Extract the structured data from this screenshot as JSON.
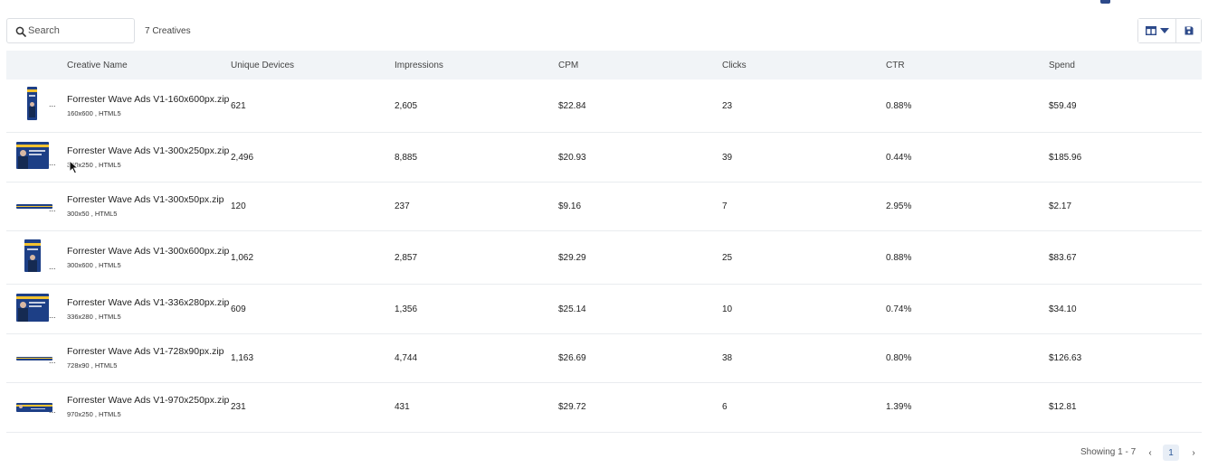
{
  "search": {
    "placeholder": "Search"
  },
  "count_label": "7 Creatives",
  "columns": {
    "creative_name": "Creative Name",
    "unique_devices": "Unique Devices",
    "impressions": "Impressions",
    "cpm": "CPM",
    "clicks": "Clicks",
    "ctr": "CTR",
    "spend": "Spend"
  },
  "rows": [
    {
      "name": "Forrester Wave Ads V1-160x600px.zip",
      "meta": "160x600 , HTML5",
      "unique_devices": "621",
      "impressions": "2,605",
      "cpm": "$22.84",
      "clicks": "23",
      "ctr": "0.88%",
      "spend": "$59.49",
      "ellipsis": "..."
    },
    {
      "name": "Forrester Wave Ads V1-300x250px.zip",
      "meta": "300x250 , HTML5",
      "unique_devices": "2,496",
      "impressions": "8,885",
      "cpm": "$20.93",
      "clicks": "39",
      "ctr": "0.44%",
      "spend": "$185.96",
      "ellipsis": "..."
    },
    {
      "name": "Forrester Wave Ads V1-300x50px.zip",
      "meta": "300x50 , HTML5",
      "unique_devices": "120",
      "impressions": "237",
      "cpm": "$9.16",
      "clicks": "7",
      "ctr": "2.95%",
      "spend": "$2.17",
      "ellipsis": "..."
    },
    {
      "name": "Forrester Wave Ads V1-300x600px.zip",
      "meta": "300x600 , HTML5",
      "unique_devices": "1,062",
      "impressions": "2,857",
      "cpm": "$29.29",
      "clicks": "25",
      "ctr": "0.88%",
      "spend": "$83.67",
      "ellipsis": "..."
    },
    {
      "name": "Forrester Wave Ads V1-336x280px.zip",
      "meta": "336x280 , HTML5",
      "unique_devices": "609",
      "impressions": "1,356",
      "cpm": "$25.14",
      "clicks": "10",
      "ctr": "0.74%",
      "spend": "$34.10",
      "ellipsis": "..."
    },
    {
      "name": "Forrester Wave Ads V1-728x90px.zip",
      "meta": "728x90 , HTML5",
      "unique_devices": "1,163",
      "impressions": "4,744",
      "cpm": "$26.69",
      "clicks": "38",
      "ctr": "0.80%",
      "spend": "$126.63",
      "ellipsis": "..."
    },
    {
      "name": "Forrester Wave Ads V1-970x250px.zip",
      "meta": "970x250 , HTML5",
      "unique_devices": "231",
      "impressions": "431",
      "cpm": "$29.72",
      "clicks": "6",
      "ctr": "1.39%",
      "spend": "$12.81",
      "ellipsis": "..."
    }
  ],
  "pagination": {
    "showing": "Showing 1 - 7",
    "current_page": "1",
    "prev_glyph": "‹",
    "next_glyph": "›"
  },
  "icons": {
    "search": "search-icon",
    "columns": "columns-icon",
    "dropdown": "caret-down-icon",
    "save": "save-icon",
    "cursor": "mouse-cursor-icon"
  },
  "colors": {
    "accent": "#2d4a8a",
    "header_bg": "#f1f4f7",
    "border": "#e9ecef",
    "active_page_bg": "#e8eef6"
  }
}
